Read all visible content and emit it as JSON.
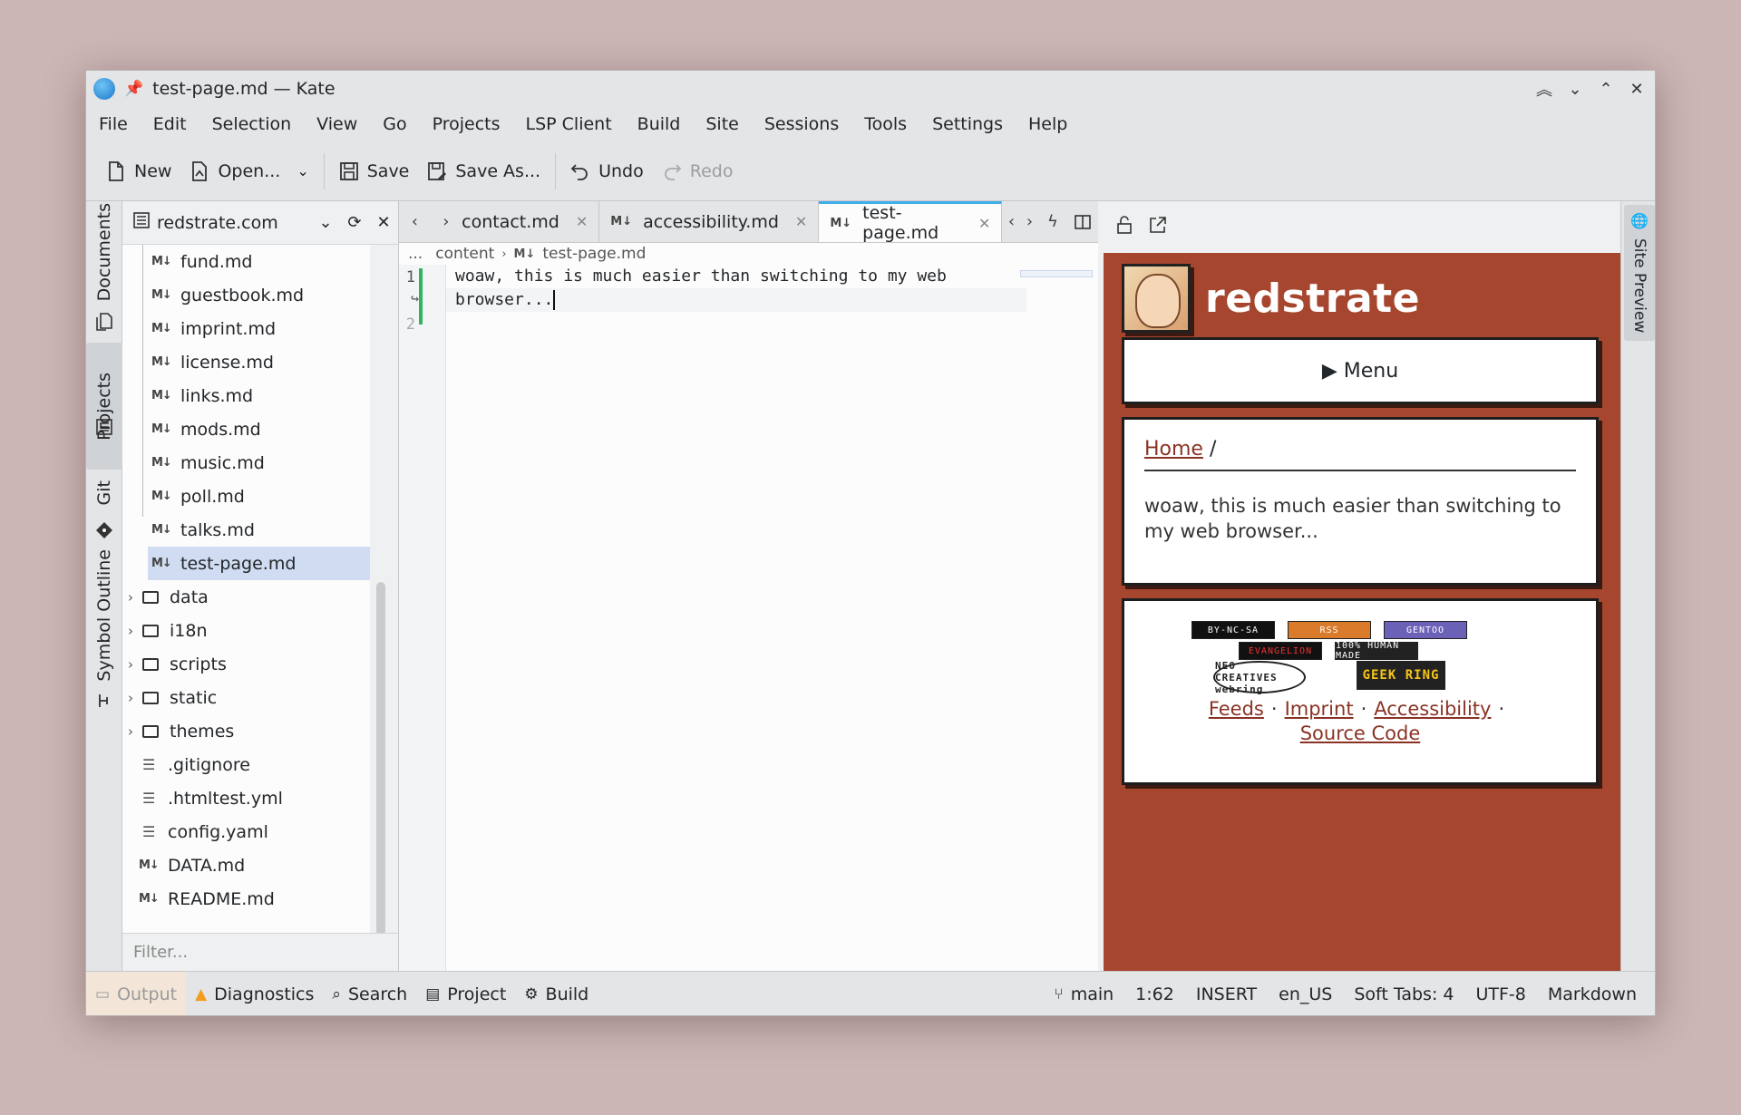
{
  "window": {
    "title": "test-page.md — Kate"
  },
  "menubar": [
    "File",
    "Edit",
    "Selection",
    "View",
    "Go",
    "Projects",
    "LSP Client",
    "Build",
    "Site",
    "Sessions",
    "Tools",
    "Settings",
    "Help"
  ],
  "toolbar": {
    "new": "New",
    "open": "Open...",
    "save": "Save",
    "save_as": "Save As...",
    "undo": "Undo",
    "redo": "Redo"
  },
  "left_tabs": {
    "documents": "Documents",
    "projects": "Projects",
    "git": "Git",
    "symbol_outline": "Symbol Outline"
  },
  "project": {
    "name": "redstrate.com",
    "files": [
      "fund.md",
      "guestbook.md",
      "imprint.md",
      "license.md",
      "links.md",
      "mods.md",
      "music.md",
      "poll.md",
      "talks.md",
      "test-page.md"
    ],
    "folders": [
      "data",
      "i18n",
      "scripts",
      "static",
      "themes"
    ],
    "root_files": [
      ".gitignore",
      ".htmltest.yml",
      "config.yaml"
    ],
    "root_md": [
      "DATA.md",
      "README.md"
    ],
    "filter_placeholder": "Filter..."
  },
  "tabs": [
    "contact.md",
    "accessibility.md",
    "test-page.md"
  ],
  "breadcrumb": {
    "ellipsis": "...",
    "folder": "content",
    "file": "test-page.md"
  },
  "editor": {
    "line1": "woaw, this is much easier than switching to my web",
    "line1_wrap": "browser...",
    "line_numbers": [
      "1",
      "2"
    ]
  },
  "preview": {
    "panel_title": "Site Preview",
    "site_title": "redstrate",
    "menu": "▶ Menu",
    "home": "Home",
    "slash": "/",
    "body": "woaw, this is much easier than switching to my web browser...",
    "badges": [
      "BY-NC-SA",
      "RSS",
      "GENTOO",
      "EVANGELION",
      "100% HUMAN MADE"
    ],
    "webrings": [
      "NEO CREATIVES webring",
      "GEEK RING"
    ],
    "footer_links": [
      "Feeds",
      "Imprint",
      "Accessibility",
      "Source Code"
    ]
  },
  "statusbar": {
    "output": "Output",
    "diagnostics": "Diagnostics",
    "search": "Search",
    "project": "Project",
    "build": "Build",
    "branch": "main",
    "position": "1:62",
    "mode": "INSERT",
    "lang": "en_US",
    "tabs": "Soft Tabs: 4",
    "encoding": "UTF-8",
    "syntax": "Markdown"
  },
  "colors": {
    "site_bg": "#a6462f",
    "link": "#8a3324",
    "selection": "#cfdcf2",
    "accent": "#3daee9",
    "modified_line": "#2fb55e"
  }
}
